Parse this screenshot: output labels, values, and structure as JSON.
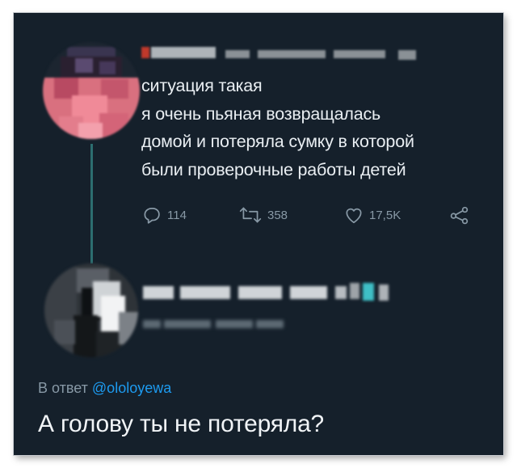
{
  "original_tweet": {
    "text_lines": [
      "ситуация такая",
      "я очень пьяная возвращалась",
      "домой и потеряла сумку в которой",
      "были проверочные работы детей"
    ],
    "reply_count": "114",
    "retweet_count": "358",
    "like_count": "17,5K"
  },
  "reply_tweet": {
    "reply_prefix": "В ответ",
    "reply_to_handle": "@ololoyewa",
    "text": "А голову ты не потеряла?"
  },
  "colors": {
    "background": "#15202b",
    "text": "#e9eef2",
    "muted": "#8899a6",
    "link": "#1d9bf0",
    "thread_line": "#2c6e70"
  },
  "icons": [
    "reply-icon",
    "retweet-icon",
    "like-icon",
    "share-icon"
  ]
}
